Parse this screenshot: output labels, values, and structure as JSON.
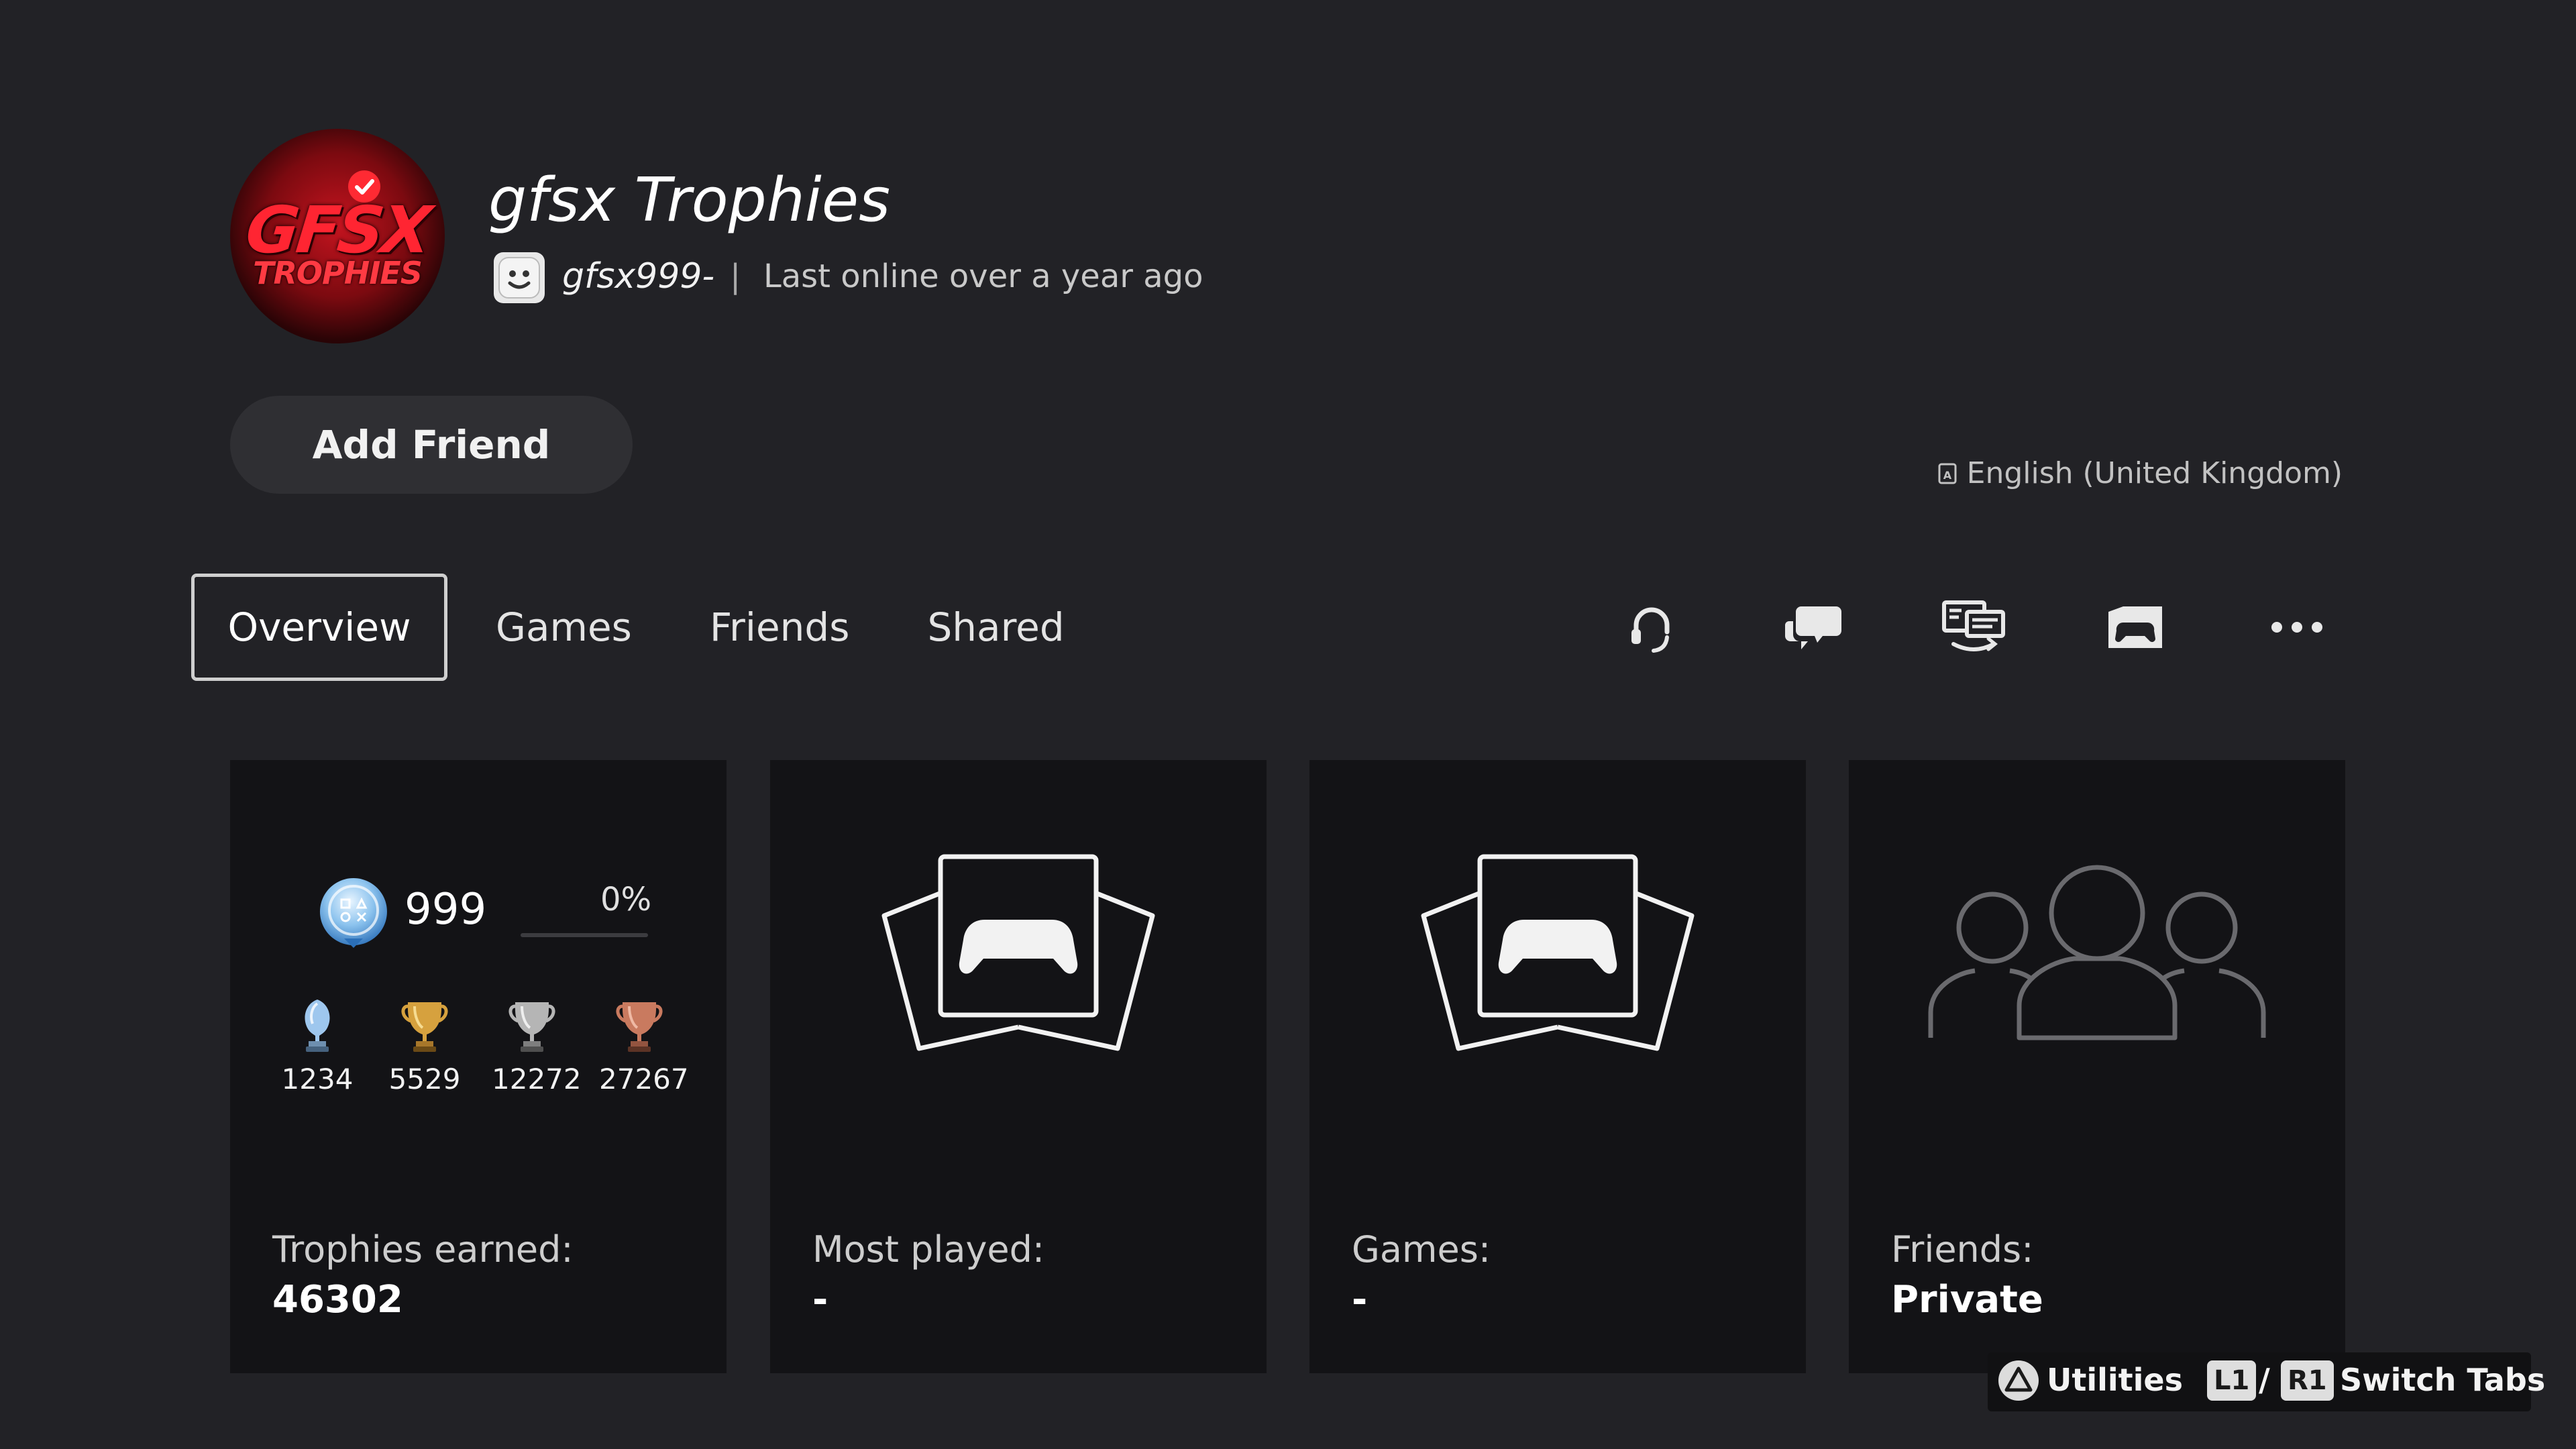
{
  "profile": {
    "name": "gfsx Trophies",
    "online_id": "gfsx999-",
    "separator": "|",
    "status": "Last online over a year ago",
    "avatar_text_main": "GFSX",
    "avatar_text_sub": "TROPHIES",
    "avatar_icon": "avatar-logo",
    "online_id_icon": "ps-avatar-face-icon"
  },
  "actions": {
    "add_friend": "Add Friend",
    "language": "English (United Kingdom)"
  },
  "tabs": [
    {
      "label": "Overview",
      "active": true
    },
    {
      "label": "Games",
      "active": false
    },
    {
      "label": "Friends",
      "active": false
    },
    {
      "label": "Shared",
      "active": false
    }
  ],
  "tab_icons": [
    "headset-icon",
    "chat-bubbles-icon",
    "share-screen-icon",
    "gameplay-share-icon",
    "more-options-icon"
  ],
  "overview": {
    "trophy_card": {
      "level": "999",
      "progress_text": "0%",
      "progress_fraction": 0,
      "trophies": [
        {
          "type": "platinum",
          "count": "1234"
        },
        {
          "type": "gold",
          "count": "5529"
        },
        {
          "type": "silver",
          "count": "12272"
        },
        {
          "type": "bronze",
          "count": "27267"
        }
      ],
      "label": "Trophies earned:",
      "value": "46302"
    },
    "most_played_card": {
      "label": "Most played:",
      "value": "-",
      "icon": "game-cards-icon"
    },
    "games_card": {
      "label": "Games:",
      "value": "-",
      "icon": "game-cards-icon"
    },
    "friends_card": {
      "label": "Friends:",
      "value": "Private",
      "icon": "people-icon"
    }
  },
  "footer": {
    "utilities_label": "Utilities",
    "l1": "L1",
    "slash": "/",
    "r1": "R1",
    "switch_tabs_label": "Switch Tabs"
  },
  "colors": {
    "background": "#222226",
    "card": "#131316",
    "platinum": "#9ec7ee",
    "gold": "#d6a13e",
    "silver": "#b5b5b5",
    "bronze": "#c97a5f"
  }
}
